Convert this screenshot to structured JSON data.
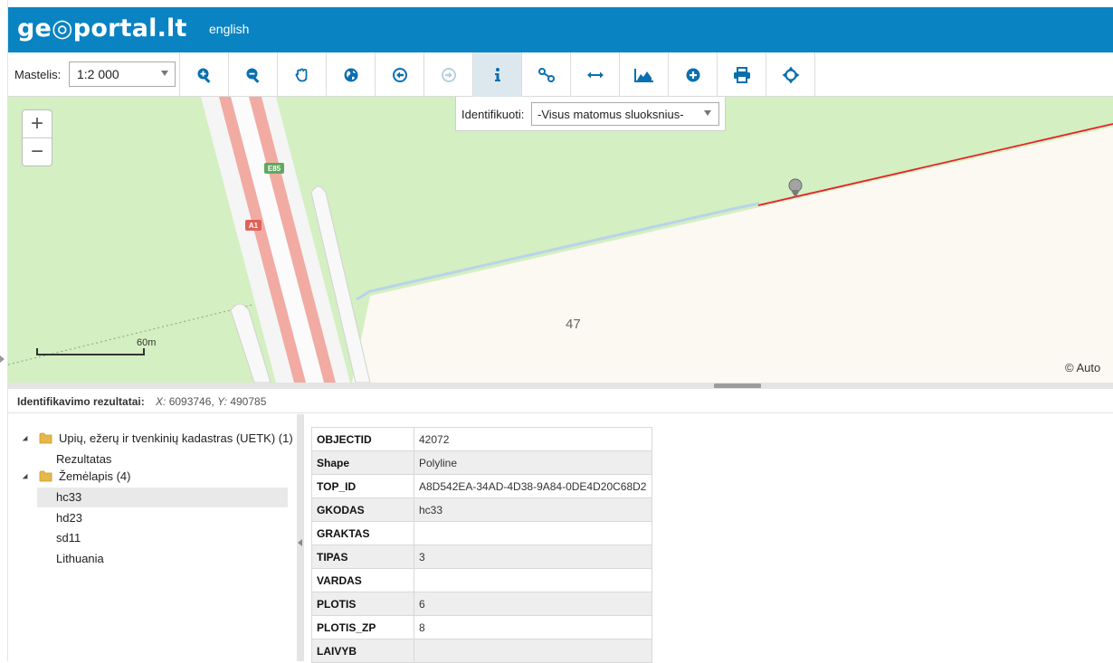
{
  "header": {
    "logo_text": "ge◎portal.lt",
    "language_link": "english"
  },
  "toolbar": {
    "scale_label": "Mastelis:",
    "scale_value": "1:2 000",
    "tools": [
      {
        "name": "zoom-in-tool",
        "icon": "zoom-in-icon"
      },
      {
        "name": "zoom-out-tool",
        "icon": "zoom-out-icon"
      },
      {
        "name": "pan-tool",
        "icon": "hand-icon"
      },
      {
        "name": "full-extent-tool",
        "icon": "globe-icon"
      },
      {
        "name": "previous-extent-tool",
        "icon": "arrow-left-circle-icon"
      },
      {
        "name": "next-extent-tool",
        "icon": "arrow-right-circle-icon",
        "disabled": true
      },
      {
        "name": "identify-tool",
        "icon": "info-icon",
        "active": true
      },
      {
        "name": "route-tool",
        "icon": "route-icon"
      },
      {
        "name": "measure-tool",
        "icon": "double-arrow-icon"
      },
      {
        "name": "elevation-profile-tool",
        "icon": "area-chart-icon"
      },
      {
        "name": "add-tool",
        "icon": "plus-circle-icon"
      },
      {
        "name": "print-tool",
        "icon": "printer-icon"
      },
      {
        "name": "locate-tool",
        "icon": "crosshair-icon"
      }
    ]
  },
  "identify": {
    "label": "Identifikuoti:",
    "selected": "-Visus matomus sluoksnius-"
  },
  "map": {
    "zoom_in_label": "+",
    "zoom_out_label": "−",
    "road_label_e85": "E85",
    "road_label_a1": "A1",
    "parcel_number": "47",
    "scalebar_label": "60m",
    "attribution": "© Auto"
  },
  "results": {
    "title": "Identifikavimo rezultatai:",
    "x_label": "X:",
    "x_value": "6093746",
    "y_label": "Y:",
    "y_value": "490785"
  },
  "tree": {
    "groups": [
      {
        "label": "Upių, ežerų ir tvenkinių kadastras (UETK) (1)",
        "children": [
          "Rezultatas"
        ]
      },
      {
        "label": "Žemėlapis (4)",
        "children": [
          "hc33",
          "hd23",
          "sd11",
          "Lithuania"
        ]
      }
    ],
    "selected": "hc33"
  },
  "attributes": {
    "rows": [
      {
        "key": "OBJECTID",
        "value": "42072"
      },
      {
        "key": "Shape",
        "value": "Polyline"
      },
      {
        "key": "TOP_ID",
        "value": "A8D542EA-34AD-4D38-9A84-0DE4D20C68D2"
      },
      {
        "key": "GKODAS",
        "value": "hc33"
      },
      {
        "key": "GRAKTAS",
        "value": ""
      },
      {
        "key": "TIPAS",
        "value": "3"
      },
      {
        "key": "VARDAS",
        "value": ""
      },
      {
        "key": "PLOTIS",
        "value": "6"
      },
      {
        "key": "PLOTIS_ZP",
        "value": "8"
      },
      {
        "key": "LAIVYB",
        "value": ""
      }
    ]
  },
  "colors": {
    "header_bg": "#0a83c2",
    "map_green": "#d4efc1",
    "map_land": "#fbf9f1",
    "road_red": "#f1aba3",
    "selected_feature": "#e8202a",
    "stream_blue": "#b9d3ea"
  }
}
